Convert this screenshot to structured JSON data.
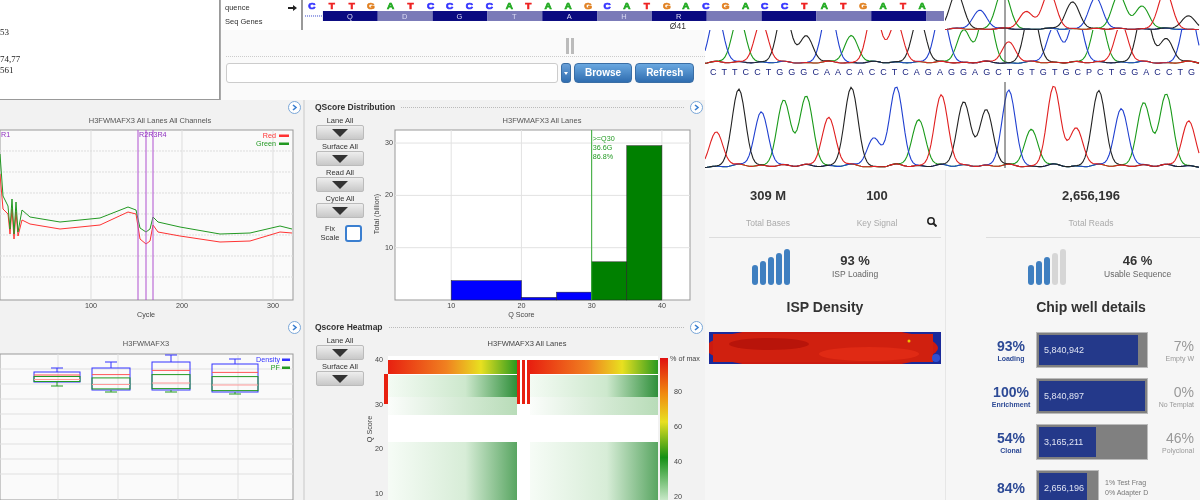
{
  "summary_box": {
    "values": [
      "53",
      "74,77",
      "561"
    ]
  },
  "sequence_track": {
    "labels": [
      "quence",
      "Seq Genes"
    ],
    "bases": [
      {
        "letter": "C",
        "color": "#3333ff"
      },
      {
        "letter": "T",
        "color": "#ee2222"
      },
      {
        "letter": "T",
        "color": "#ee2222"
      },
      {
        "letter": "G",
        "color": "#e08020"
      },
      {
        "letter": "A",
        "color": "#22aa22"
      },
      {
        "letter": "T",
        "color": "#ee2222"
      },
      {
        "letter": "C",
        "color": "#3333ff"
      },
      {
        "letter": "C",
        "color": "#3333ff"
      },
      {
        "letter": "C",
        "color": "#3333ff"
      },
      {
        "letter": "C",
        "color": "#3333ff"
      },
      {
        "letter": "A",
        "color": "#22aa22"
      },
      {
        "letter": "T",
        "color": "#ee2222"
      },
      {
        "letter": "A",
        "color": "#22aa22"
      },
      {
        "letter": "A",
        "color": "#22aa22"
      },
      {
        "letter": "G",
        "color": "#e08020"
      },
      {
        "letter": "C",
        "color": "#3333ff"
      },
      {
        "letter": "A",
        "color": "#22aa22"
      },
      {
        "letter": "T",
        "color": "#ee2222"
      },
      {
        "letter": "G",
        "color": "#e08020"
      },
      {
        "letter": "A",
        "color": "#22aa22"
      },
      {
        "letter": "C",
        "color": "#3333ff"
      },
      {
        "letter": "G",
        "color": "#e08020"
      },
      {
        "letter": "A",
        "color": "#22aa22"
      },
      {
        "letter": "C",
        "color": "#3333ff"
      },
      {
        "letter": "C",
        "color": "#3333ff"
      },
      {
        "letter": "T",
        "color": "#ee2222"
      },
      {
        "letter": "A",
        "color": "#22aa22"
      },
      {
        "letter": "T",
        "color": "#ee2222"
      },
      {
        "letter": "G",
        "color": "#e08020"
      },
      {
        "letter": "A",
        "color": "#22aa22"
      },
      {
        "letter": "T",
        "color": "#ee2222"
      },
      {
        "letter": "A",
        "color": "#22aa22"
      }
    ],
    "amino_acids": [
      "Q",
      "D",
      "G",
      "T",
      "A",
      "H",
      "R"
    ],
    "feature_label": "Ø41"
  },
  "browse_bar": {
    "buttons": [
      "Browse",
      "Refresh"
    ]
  },
  "chromatogram": {
    "bases": "CTTCCTGGGCAACACCTCAGAGGAGCTGTGTGCPCTGGACCTG"
  },
  "intensity_panel": {
    "title": "H3FWMAFX3 All Lanes All Channels",
    "markers": [
      "R1",
      "R2R3R4"
    ],
    "legend": [
      {
        "label": "Red",
        "color": "#ff3333"
      },
      {
        "label": "Green",
        "color": "#229922"
      }
    ],
    "xticks": [
      "100",
      "200",
      "300"
    ],
    "xlabel": "Cycle"
  },
  "qscore_distribution": {
    "title": "QScore Distribution",
    "filters": [
      "Lane All",
      "Surface All",
      "Read All",
      "Cycle All"
    ],
    "fix_scale": {
      "label": "Fix Scale",
      "checked": false
    },
    "chart_data": {
      "type": "bar",
      "title": "H3FWMAFX3 All Lanes",
      "xlabel": "Q Score",
      "ylabel": "Total (billion)",
      "x": [
        15,
        22.5,
        27.5,
        32.5,
        37.5
      ],
      "series": [
        {
          "color": "#0000ff",
          "values": [
            3.7,
            0.5,
            1.5,
            null,
            null
          ]
        },
        {
          "color": "#008000",
          "values": [
            null,
            null,
            null,
            7.3,
            29.5
          ]
        }
      ],
      "xlim": [
        2,
        44
      ],
      "ylim": [
        0,
        32.5
      ],
      "xticks": [
        10,
        20,
        30,
        40
      ],
      "yticks": [
        10,
        20,
        30
      ],
      "grid": true,
      "ref_lines": [
        {
          "axis": "x",
          "value": 30,
          "color": "#33aa33"
        }
      ],
      "annotations": [
        ">=Q30",
        "36.6G",
        "86.8%"
      ]
    }
  },
  "box_plot_panel": {
    "title": "H3FWMAFX3",
    "legend": [
      {
        "label": "Density",
        "color": "#3333ff"
      },
      {
        "label": "PF",
        "color": "#229922"
      }
    ]
  },
  "qscore_heatmap": {
    "title": "Qscore Heatmap",
    "filters": [
      "Lane All",
      "Surface All"
    ],
    "chart_title": "H3FWMAFX3 All Lanes",
    "yticks": [
      "40",
      "30",
      "20",
      "10"
    ],
    "ylabel": "Q Score",
    "scale_label": "% of max",
    "scale_ticks": [
      "80",
      "60",
      "40",
      "20"
    ]
  },
  "run_summary": {
    "stats": [
      {
        "value": "309 M",
        "label": "Total Bases"
      },
      {
        "value": "100",
        "label": "Key Signal"
      }
    ],
    "isp_loading": {
      "value": "93 %",
      "label": "ISP Loading"
    },
    "density_title": "ISP Density"
  },
  "read_summary": {
    "stats": [
      {
        "value": "2,656,196",
        "label": "Total Reads"
      }
    ],
    "usable": {
      "value": "46 %",
      "label": "Usable Sequence"
    },
    "title": "Chip well details",
    "rows": [
      {
        "kind": "bar",
        "percent": "93%",
        "label": "Loading",
        "count": "5,840,942",
        "level": 0.93,
        "other_percent": "7%",
        "other_label": "Empty W"
      },
      {
        "kind": "bar",
        "percent": "100%",
        "label": "Enrichment",
        "count": "5,840,897",
        "level": 1.0,
        "other_percent": "0%",
        "other_label": "No Templat"
      },
      {
        "kind": "bar",
        "percent": "54%",
        "label": "Clonal",
        "count": "3,165,211",
        "level": 0.54,
        "other_percent": "46%",
        "other_label": "Polyclonal"
      },
      {
        "kind": "notes",
        "percent": "84%",
        "count": "2,656,196",
        "level": 0.84,
        "notes": [
          "1% Test Frag",
          "0% Adapter D"
        ]
      }
    ]
  }
}
